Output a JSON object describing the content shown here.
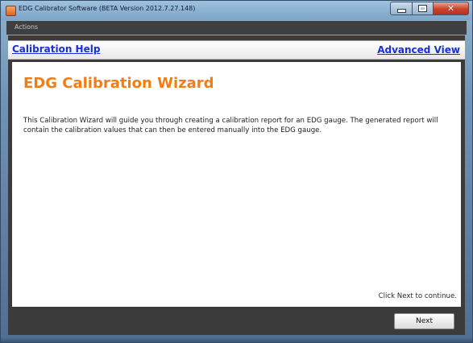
{
  "window": {
    "title": "EDG Calibrator Software (BETA Version 2012.7.27.148)",
    "icon": "app-icon",
    "buttons": [
      "minimize-icon",
      "maximize-icon",
      "close-icon"
    ]
  },
  "menubar": {
    "items": [
      {
        "label": "Actions"
      }
    ]
  },
  "header": {
    "help_label": "Calibration Help",
    "advanced_label": "Advanced View",
    "link_color": "#1a2fd8"
  },
  "wizard": {
    "title": "EDG Calibration Wizard",
    "title_color": "#f07d16",
    "intro": "This Calibration Wizard will guide you through creating a calibration report for an EDG gauge.  The generated report will contain the calibration values that can then be entered manually into the EDG gauge.",
    "hint": "Click Next to continue."
  },
  "footer": {
    "next_label": "Next"
  }
}
